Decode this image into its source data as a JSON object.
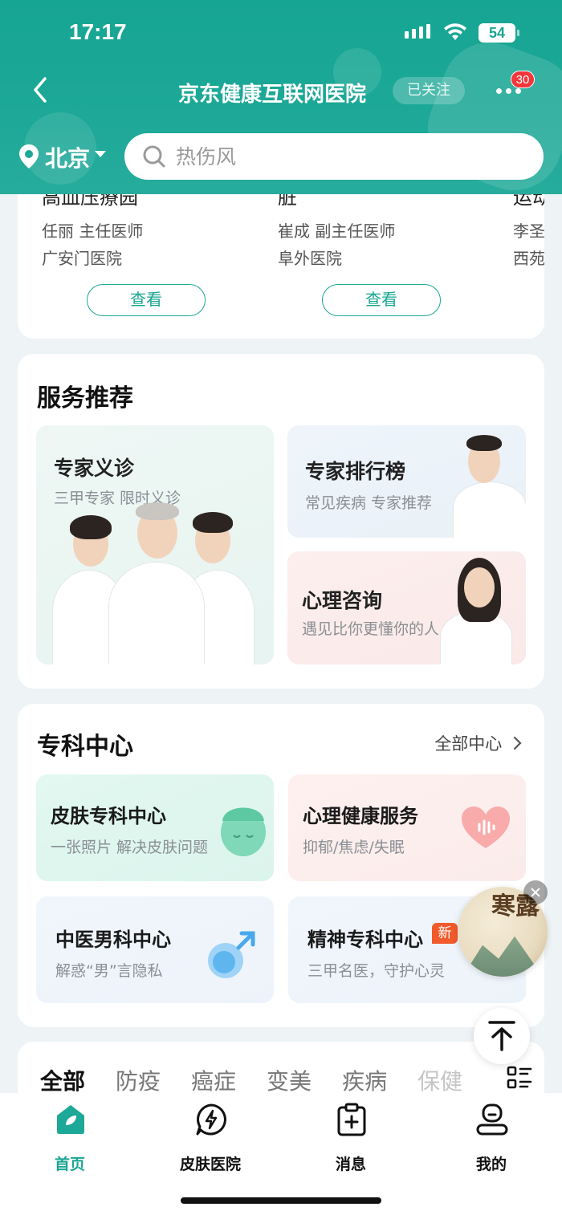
{
  "status_bar": {
    "time": "17:17",
    "battery": "54"
  },
  "header": {
    "title": "京东健康互联网医院",
    "follow_status": "已关注",
    "notification_count": "30",
    "city": "北京",
    "search_placeholder": "热伤风"
  },
  "doctors": [
    {
      "partial_title": "高血压療园",
      "name": "任丽  主任医师",
      "hospital": "广安门医院",
      "button": "查看"
    },
    {
      "partial_title": "脏",
      "name": "崔成  副主任医师",
      "hospital": "阜外医院",
      "button": "查看"
    },
    {
      "partial_title": "运动",
      "name": "李圣",
      "hospital": "西苑"
    }
  ],
  "services": {
    "title": "服务推荐",
    "items": [
      {
        "title": "专家义诊",
        "subtitle": "三甲专家 限时义诊"
      },
      {
        "title": "专家排行榜",
        "subtitle": "常见疾病 专家推荐"
      },
      {
        "title": "心理咨询",
        "subtitle": "遇见比你更懂你的人"
      }
    ]
  },
  "specialty": {
    "title": "专科中心",
    "all_link": "全部中心",
    "items": [
      {
        "title": "皮肤专科中心",
        "subtitle": "一张照片 解决皮肤问题"
      },
      {
        "title": "心理健康服务",
        "subtitle": "抑郁/焦虑/失眠"
      },
      {
        "title": "中医男科中心",
        "subtitle": "解惑“男”言隐私"
      },
      {
        "title": "精神专科中心",
        "subtitle": "三甲名医，守护心灵",
        "badge": "新"
      }
    ]
  },
  "float_ad": {
    "text": "寒露"
  },
  "category_tabs": [
    "全部",
    "防疫",
    "癌症",
    "变美",
    "疾病",
    "保健"
  ],
  "bottom_nav": [
    {
      "label": "首页",
      "icon": "home-icon",
      "active": true
    },
    {
      "label": "皮肤医院",
      "icon": "lightning-icon",
      "active": false
    },
    {
      "label": "消息",
      "icon": "clipboard-plus-icon",
      "active": false
    },
    {
      "label": "我的",
      "icon": "profile-icon",
      "active": false
    }
  ],
  "colors": {
    "brand": "#1da897",
    "active_nav": "#1aa593",
    "badge_red": "#f2363b",
    "new_badge": "#f15a2b"
  }
}
